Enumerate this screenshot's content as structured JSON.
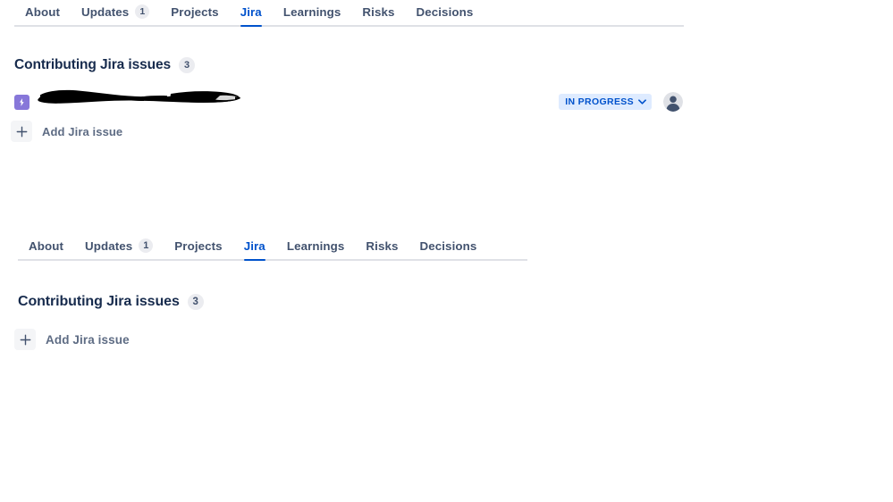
{
  "panels": [
    {
      "id": "top",
      "tabs": [
        {
          "label": "About",
          "badge": null,
          "active": false
        },
        {
          "label": "Updates",
          "badge": "1",
          "active": false
        },
        {
          "label": "Projects",
          "badge": null,
          "active": false
        },
        {
          "label": "Jira",
          "badge": null,
          "active": true
        },
        {
          "label": "Learnings",
          "badge": null,
          "active": false
        },
        {
          "label": "Risks",
          "badge": null,
          "active": false
        },
        {
          "label": "Decisions",
          "badge": null,
          "active": false
        }
      ],
      "section": {
        "title": "Contributing Jira issues",
        "count": "3"
      },
      "issues": [
        {
          "type_icon": "jira-task-icon",
          "title": "",
          "redacted": true,
          "status": "IN PROGRESS",
          "status_text_color": "#0052CC",
          "status_bg_color": "#DEEBFF",
          "assignee_icon": "person-avatar-icon"
        }
      ],
      "add_button": {
        "label": "Add Jira issue",
        "icon": "plus-icon"
      }
    },
    {
      "id": "bottom",
      "tabs": [
        {
          "label": "About",
          "badge": null,
          "active": false
        },
        {
          "label": "Updates",
          "badge": "1",
          "active": false
        },
        {
          "label": "Projects",
          "badge": null,
          "active": false
        },
        {
          "label": "Jira",
          "badge": null,
          "active": true
        },
        {
          "label": "Learnings",
          "badge": null,
          "active": false
        },
        {
          "label": "Risks",
          "badge": null,
          "active": false
        },
        {
          "label": "Decisions",
          "badge": null,
          "active": false
        }
      ],
      "section": {
        "title": "Contributing Jira issues",
        "count": "3"
      },
      "issues": [],
      "add_button": {
        "label": "Add Jira issue",
        "icon": "plus-icon"
      }
    }
  ],
  "colors": {
    "accent": "#0052CC",
    "text": "#172B4D",
    "subtle_text": "#42526E",
    "muted_text": "#5E6C84",
    "divider": "#DFE1E6",
    "badge_bg": "#EBECF0",
    "jira_icon_purple": "#8777D9",
    "redaction": "#000000"
  }
}
